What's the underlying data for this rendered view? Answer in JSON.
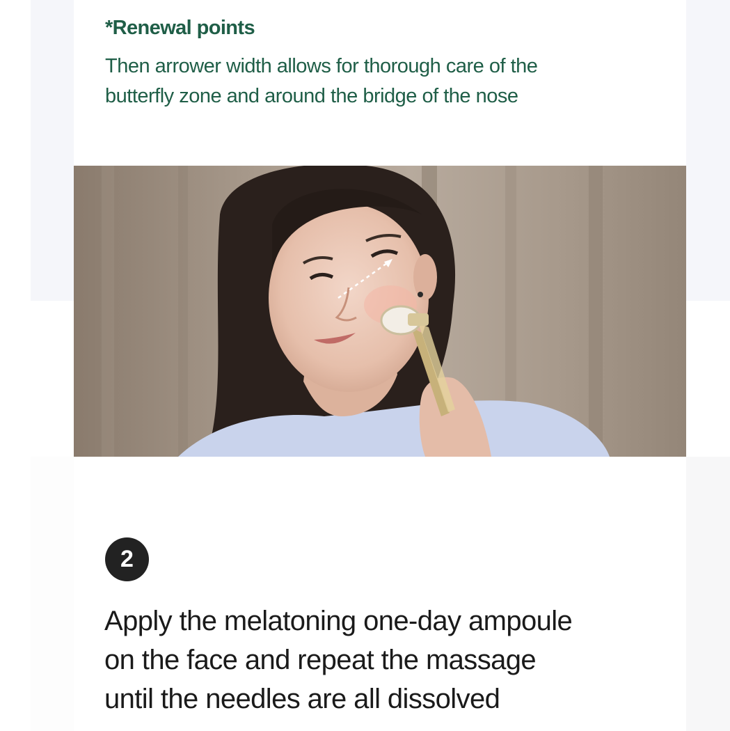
{
  "renewal": {
    "title": "*Renewal points",
    "description_lines": [
      "Then arrower width allows for thorough care of the",
      "butterfly zone and around the bridge of the nose"
    ]
  },
  "photo": {
    "subject": "woman using facial roller on cheek"
  },
  "step": {
    "number": "2",
    "lines": [
      "Apply the melatoning one-day ampoule",
      "on the face and repeat the massage",
      "until the needles are all dissolved"
    ]
  },
  "colors": {
    "accent_green": "#1f5e47",
    "badge": "#222222",
    "body_text": "#1a1a1a"
  }
}
